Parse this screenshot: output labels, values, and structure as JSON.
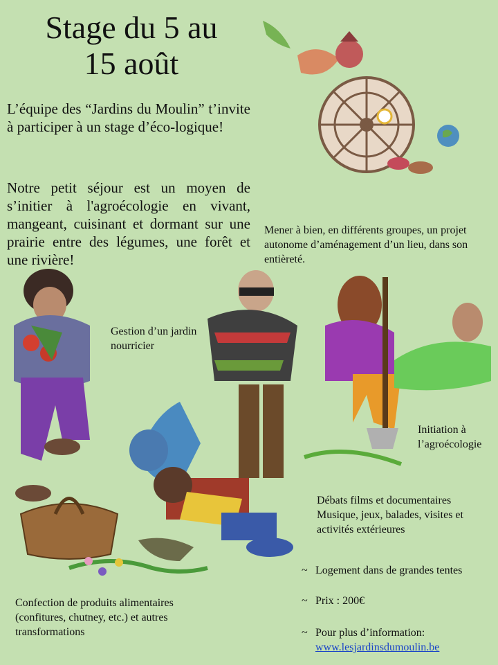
{
  "title": {
    "line1": "Stage du 5 au",
    "line2": "15 août"
  },
  "intro": {
    "p1": "L’équipe des “Jardins du Moulin” t’invite à participer à un stage d’éco-logique!",
    "p2": "Notre petit séjour est un moyen de s’initier à l'agroécologie en vivant, mangeant, cuisinant et dormant sur une prairie entre des légumes, une forêt et une rivière!"
  },
  "captions": {
    "mener": "Mener à bien, en différents groupes, un projet autonome d’aménagement d’un lieu, dans son entièreté.",
    "gestion": "Gestion d’un jardin nourricier",
    "initiation": "Initiation à l’agroécologie",
    "debats_1": "Débats films et documentaires",
    "debats_2": "Musique, jeux, balades, visites et activités extérieures",
    "confection": "Confection de produits alimentaires (confitures, chutney, etc.) et autres transformations"
  },
  "info": {
    "bullet": "~",
    "logement": "Logement dans de grandes tentes",
    "prix": "Prix : 200€",
    "plus": "Pour plus d’information:",
    "link": "www.lesjardinsdumoulin.be"
  },
  "colors": {
    "background": "#c4e0b1",
    "link": "#1a44c8"
  },
  "illustrations": [
    "water-wheel-vegetables-drawing",
    "gardener-with-vegetables-drawing",
    "people-working-garden-drawing",
    "basket-drawing",
    "person-with-shovel-drawing"
  ]
}
